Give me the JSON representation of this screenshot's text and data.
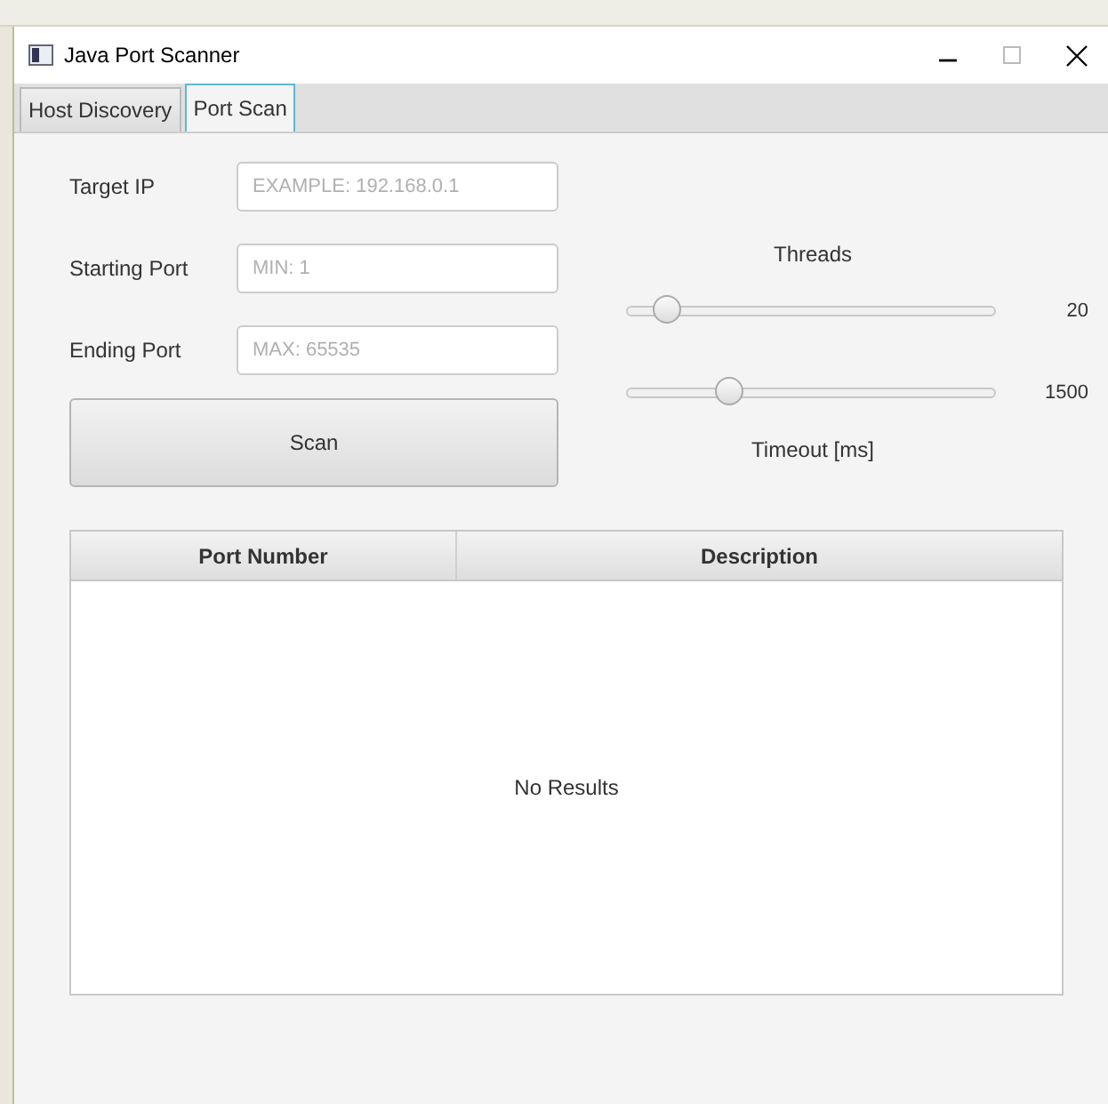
{
  "window": {
    "title": "Java Port Scanner"
  },
  "tabs": [
    {
      "label": "Host Discovery",
      "selected": false
    },
    {
      "label": "Port Scan",
      "selected": true
    }
  ],
  "fields": [
    {
      "label": "Target IP",
      "placeholder": "EXAMPLE: 192.168.0.1"
    },
    {
      "label": "Starting Port",
      "placeholder": "MIN: 1"
    },
    {
      "label": "Ending Port",
      "placeholder": "MAX: 65535"
    }
  ],
  "scan_button": "Scan",
  "sliders": [
    {
      "caption": "Threads",
      "level": 0.08,
      "reading": "20"
    },
    {
      "caption": "Timeout [ms]",
      "level": 0.26,
      "reading": "1500"
    }
  ],
  "table": {
    "columns": [
      "Port Number",
      "Description"
    ],
    "empty_text": "No Results"
  }
}
